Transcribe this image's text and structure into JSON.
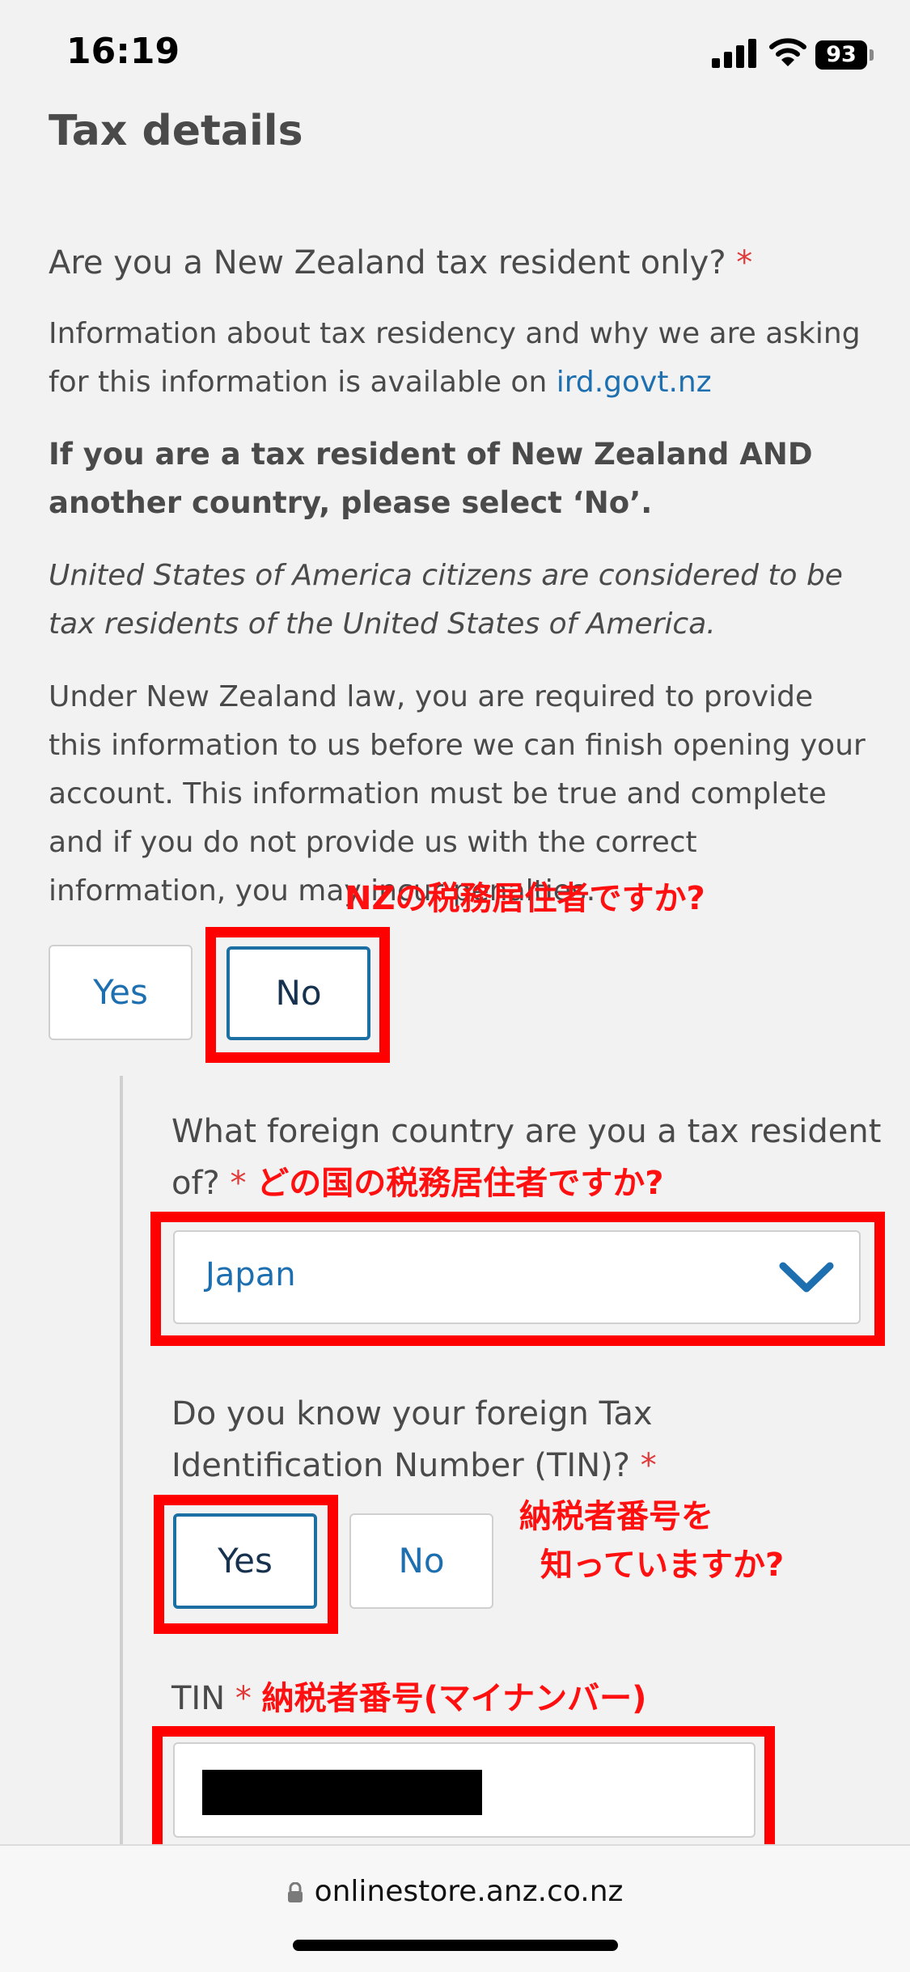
{
  "status_bar": {
    "time": "16:19",
    "battery": "93"
  },
  "page": {
    "title": "Tax details"
  },
  "question1": {
    "text": "Are you a New Zealand tax resident only?",
    "required": "*",
    "info_text": "Information about tax residency and why we are asking for this information is available on ",
    "info_link": "ird.govt.nz",
    "bold_note": "If you are a tax resident of New Zealand AND another country, please select ‘No’.",
    "italic_note": "United States of America citizens are considered to be tax residents of the United States of America.",
    "law_text": "Under New Zealand law, you are required to provide this information to us before we can finish opening your account. This information must be true and complete and if you do not provide us with the correct information, you may incur penalties.",
    "annotation": "NZの税務居住者ですか?",
    "yes_label": "Yes",
    "no_label": "No"
  },
  "question2": {
    "text": "What foreign country are you a tax resident of?",
    "required": "*",
    "annotation": "どの国の税務居住者ですか?",
    "selected_value": "Japan"
  },
  "question3": {
    "text": "Do you know your foreign Tax Identification Number (TIN)?",
    "required": "*",
    "annotation_line1": "納税者番号を",
    "annotation_line2": "知っていますか?",
    "yes_label": "Yes",
    "no_label": "No"
  },
  "tin_field": {
    "label": "TIN",
    "required": "*",
    "annotation": "納税者番号(マイナンバー)"
  },
  "browser": {
    "url": "onlinestore.anz.co.nz"
  },
  "colors": {
    "accent": "#1d6fb0",
    "annotation_red": "#ff0000",
    "required_red": "#e03a3a"
  }
}
